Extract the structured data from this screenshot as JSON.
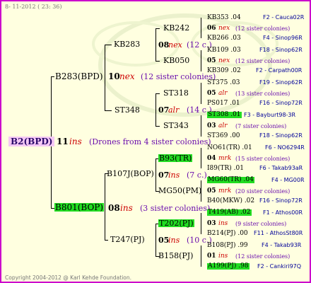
{
  "date": "8- 11-2012 ( 23: 36)",
  "copyright": "Copyright 2004-2012 @ Karl Kehde Foundation.",
  "root": {
    "label": "B2(BPD)",
    "gen": "11",
    "mark": "ins",
    "note": "(Drones from 4 sister colonies)"
  },
  "l1": {
    "top": {
      "label": "B283(BPD)",
      "gen": "10",
      "mark": "nex",
      "note": "(12 sister colonies)"
    },
    "bot": {
      "label": "B801(BOP)",
      "gen": "08",
      "mark": "ins",
      "note": "(3 sister colonies)"
    }
  },
  "l2": {
    "kb283": {
      "label": "KB283",
      "gen": "08",
      "mark": "nex",
      "note": "(12 c.)"
    },
    "st348": {
      "label": "ST348",
      "gen": "07",
      "mark": "alr",
      "note": "(14 c.)"
    },
    "b107j": {
      "label": "B107J(BOP)",
      "gen": "07",
      "mark": "ins",
      "note": "(7 c.)"
    },
    "t247": {
      "label": "T247(PJ)",
      "gen": "05",
      "mark": "ins",
      "note": "(10 c.)"
    }
  },
  "l3": {
    "kb242": "KB242",
    "kb050": "KB050",
    "st318": "ST318",
    "st343": "ST343",
    "b93": "B93(TR)",
    "mg50": "MG50(PM)",
    "t202": "T202(PJ)",
    "b158": "B158(PJ)"
  },
  "l4": [
    {
      "left": "KB353 .04",
      "right": "F2 - Cauca02R"
    },
    {
      "gen": "06",
      "mark": "nex",
      "note": "(12 sister colonies)"
    },
    {
      "left": "KB266 .03",
      "right": "F4 - Sinop96R"
    },
    {
      "left": "KB109 .03",
      "right": "F18 - Sinop62R"
    },
    {
      "gen": "05",
      "mark": "nex",
      "note": "(12 sister colonies)"
    },
    {
      "left": "KB309 .02",
      "right": "F2 - Carpath00R"
    },
    {
      "left": "ST375 .03",
      "right": "F19 - Sinop62R"
    },
    {
      "gen": "05",
      "mark": "alr",
      "note": "(13 sister colonies)"
    },
    {
      "left": "PS017 .01",
      "right": "F16 - Sinop72R"
    },
    {
      "left": "ST308 .01",
      "right": "F3 - Bayburt98-3R"
    },
    {
      "gen": "03",
      "mark": "alr",
      "note": "(7 sister colonies)"
    },
    {
      "left": "ST369 .00",
      "right": "F18 - Sinop62R"
    },
    {
      "left": "NO61(TR) .01",
      "right": "F6 - NO6294R"
    },
    {
      "gen": "04",
      "mark": "mrk",
      "note": "(15 sister colonies)"
    },
    {
      "left": "I89(TR) .01",
      "right": "F6 - Takab93aR"
    },
    {
      "left": "MG60(TR) .04",
      "right": "F4 - MG00R"
    },
    {
      "gen": "05",
      "mark": "mrk",
      "note": "(20 sister colonies)"
    },
    {
      "left": "B40(MKW) .02",
      "right": "F16 - Sinop72R"
    },
    {
      "left": "T419(AB) .02",
      "right": "F1 - Athos00R"
    },
    {
      "gen": "03",
      "mark": "ins",
      "note": "(9 sister colonies)"
    },
    {
      "left": "B214(PJ) .00",
      "right": "F11 - AthosSt80R"
    },
    {
      "left": "B108(PJ) .99",
      "right": "F4 - Takab93R"
    },
    {
      "gen": "01",
      "mark": "ins",
      "note": "(12 sister colonies)"
    },
    {
      "left": "A199(PJ) .98",
      "right": "F2 - Cankiri97Q"
    }
  ]
}
